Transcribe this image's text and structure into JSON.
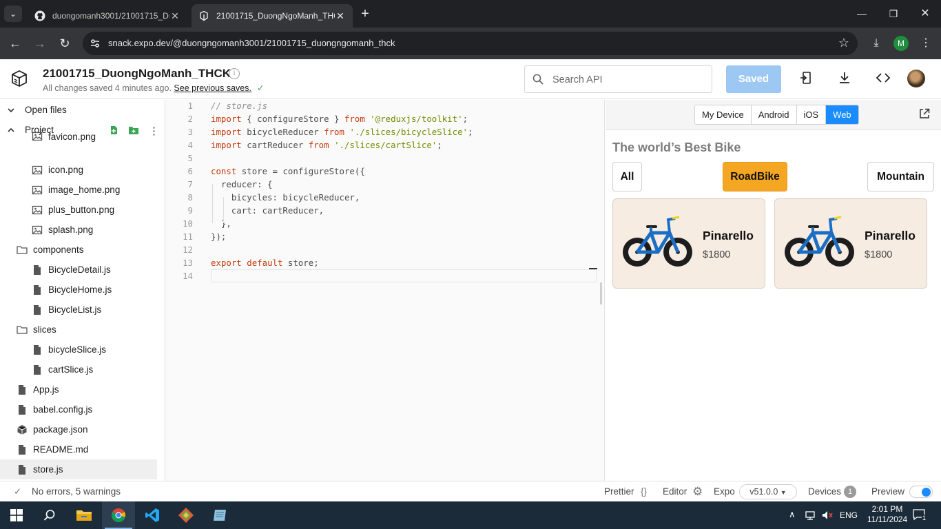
{
  "browser": {
    "tabs": [
      {
        "title": "duongomanh3001/21001715_Du",
        "active": false
      },
      {
        "title": "21001715_DuongNgoManh_THCK",
        "active": true
      }
    ],
    "url": "snack.expo.dev/@duongngomanh3001/21001715_duongngomanh_thck",
    "profile_initial": "M"
  },
  "header": {
    "project_title": "21001715_DuongNgoManh_THCK",
    "saved_status": "All changes saved 4 minutes ago.",
    "previous_saves_link": "See previous saves.",
    "search_placeholder": "Search API",
    "saved_button": "Saved"
  },
  "sidebar": {
    "open_files": "Open files",
    "project": "Project",
    "items": [
      {
        "label": "favicon.png",
        "type": "image",
        "depth": 2
      },
      {
        "label": "icon.png",
        "type": "image",
        "depth": 2
      },
      {
        "label": "image_home.png",
        "type": "image",
        "depth": 2
      },
      {
        "label": "plus_button.png",
        "type": "image",
        "depth": 2
      },
      {
        "label": "splash.png",
        "type": "image",
        "depth": 2
      },
      {
        "label": "components",
        "type": "folder",
        "depth": 1
      },
      {
        "label": "BicycleDetail.js",
        "type": "file",
        "depth": 2
      },
      {
        "label": "BicycleHome.js",
        "type": "file",
        "depth": 2
      },
      {
        "label": "BicycleList.js",
        "type": "file",
        "depth": 2
      },
      {
        "label": "slices",
        "type": "folder",
        "depth": 1
      },
      {
        "label": "bicycleSlice.js",
        "type": "file",
        "depth": 2
      },
      {
        "label": "cartSlice.js",
        "type": "file",
        "depth": 2
      },
      {
        "label": "App.js",
        "type": "file",
        "depth": 1
      },
      {
        "label": "babel.config.js",
        "type": "file",
        "depth": 1
      },
      {
        "label": "package.json",
        "type": "package",
        "depth": 1
      },
      {
        "label": "README.md",
        "type": "file",
        "depth": 1
      },
      {
        "label": "store.js",
        "type": "file",
        "depth": 1,
        "selected": true
      }
    ]
  },
  "editor": {
    "lines": [
      {
        "n": "1",
        "tokens": [
          {
            "t": "// store.js",
            "c": "cmt"
          }
        ]
      },
      {
        "n": "2",
        "tokens": [
          {
            "t": "import",
            "c": "kw"
          },
          {
            "t": " { configureStore } ",
            "c": ""
          },
          {
            "t": "from",
            "c": "kw"
          },
          {
            "t": " ",
            "c": ""
          },
          {
            "t": "'@reduxjs/toolkit'",
            "c": "str"
          },
          {
            "t": ";",
            "c": ""
          }
        ]
      },
      {
        "n": "3",
        "tokens": [
          {
            "t": "import",
            "c": "kw"
          },
          {
            "t": " bicycleReducer ",
            "c": ""
          },
          {
            "t": "from",
            "c": "kw"
          },
          {
            "t": " ",
            "c": ""
          },
          {
            "t": "'./slices/bicycleSlice'",
            "c": "str"
          },
          {
            "t": ";",
            "c": ""
          }
        ]
      },
      {
        "n": "4",
        "tokens": [
          {
            "t": "import",
            "c": "kw"
          },
          {
            "t": " cartReducer ",
            "c": ""
          },
          {
            "t": "from",
            "c": "kw"
          },
          {
            "t": " ",
            "c": ""
          },
          {
            "t": "'./slices/cartSlice'",
            "c": "str"
          },
          {
            "t": ";",
            "c": ""
          }
        ]
      },
      {
        "n": "5",
        "tokens": []
      },
      {
        "n": "6",
        "tokens": [
          {
            "t": "const",
            "c": "kw"
          },
          {
            "t": " store = configureStore({",
            "c": ""
          }
        ]
      },
      {
        "n": "7",
        "tokens": [
          {
            "t": "  reducer: {",
            "c": ""
          }
        ]
      },
      {
        "n": "8",
        "tokens": [
          {
            "t": "    bicycles: bicycleReducer,",
            "c": ""
          }
        ]
      },
      {
        "n": "9",
        "tokens": [
          {
            "t": "    cart: cartReducer,",
            "c": ""
          }
        ]
      },
      {
        "n": "10",
        "tokens": [
          {
            "t": "  },",
            "c": ""
          }
        ]
      },
      {
        "n": "11",
        "tokens": [
          {
            "t": "});",
            "c": ""
          }
        ]
      },
      {
        "n": "12",
        "tokens": []
      },
      {
        "n": "13",
        "tokens": [
          {
            "t": "export",
            "c": "kw"
          },
          {
            "t": " ",
            "c": ""
          },
          {
            "t": "default",
            "c": "kw"
          },
          {
            "t": " store;",
            "c": ""
          }
        ]
      },
      {
        "n": "14",
        "tokens": []
      }
    ]
  },
  "preview": {
    "platforms": [
      "My Device",
      "Android",
      "iOS",
      "Web"
    ],
    "active_platform": "Web",
    "app_title": "The world’s Best Bike",
    "categories": [
      "All",
      "RoadBike",
      "Mountain"
    ],
    "active_category": "RoadBike",
    "products": [
      {
        "name": "Pinarello",
        "price": "$1800"
      },
      {
        "name": "Pinarello",
        "price": "$1800"
      }
    ]
  },
  "status": {
    "problems": "No errors, 5 warnings",
    "prettier": "Prettier",
    "editor": "Editor",
    "expo": "Expo",
    "version": "v51.0.0",
    "devices": "Devices",
    "devices_count": "1",
    "preview": "Preview"
  },
  "taskbar": {
    "lang": "ENG",
    "time": "2:01 PM",
    "date": "11/11/2024",
    "notifications": "1"
  },
  "colors": {
    "accent": "#1a8cff",
    "category_active": "#f5a623",
    "saved_button": "#9dc8f3"
  }
}
